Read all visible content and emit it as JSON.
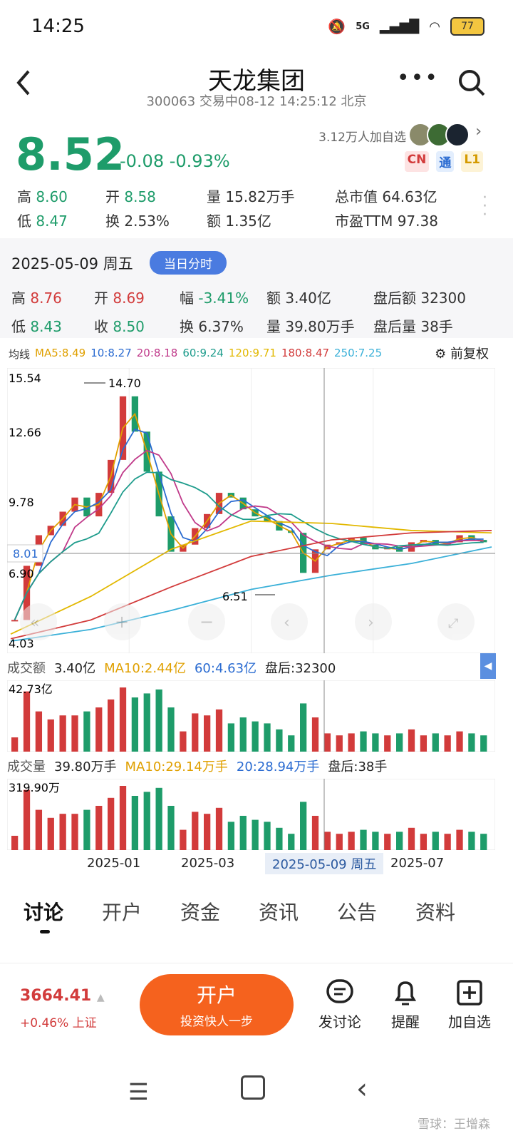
{
  "status_bar": {
    "time": "14:25",
    "network": "5G",
    "battery": "77"
  },
  "header": {
    "title": "天龙集团",
    "subtitle": "300063 交易中08-12 14:25:12 北京"
  },
  "quote": {
    "price": "8.52",
    "change": "-0.08",
    "change_pct": "-0.93%",
    "followers": "3.12万人加自选",
    "badges": [
      "CN",
      "通",
      "L1"
    ],
    "high_label": "高",
    "high": "8.60",
    "open_label": "开",
    "open": "8.58",
    "volume_label": "量",
    "volume": "15.82万手",
    "mktcap_label": "总市值",
    "mktcap": "64.63亿",
    "low_label": "低",
    "low": "8.47",
    "turnover_label": "换",
    "turnover": "2.53%",
    "amount_label": "额",
    "amount": "1.35亿",
    "pe_label": "市盈TTM",
    "pe": "97.38"
  },
  "day_panel": {
    "date": "2025-05-09 周五",
    "intraday_btn": "当日分时",
    "high_label": "高",
    "high": "8.76",
    "open_label": "开",
    "open": "8.69",
    "amp_label": "幅",
    "amp": "-3.41%",
    "amt_label": "额",
    "amt": "3.40亿",
    "after_amt_label": "盘后额",
    "after_amt": "32300",
    "low_label": "低",
    "low": "8.43",
    "close_label": "收",
    "close": "8.50",
    "turn_label": "换",
    "turn": "6.37%",
    "vol_label": "量",
    "vol": "39.80万手",
    "after_vol_label": "盘后量",
    "after_vol": "38手"
  },
  "ma_legend": {
    "label": "均线",
    "items": [
      {
        "text": "MA5:8.49",
        "color": "#e0a000"
      },
      {
        "text": "10:8.27",
        "color": "#2a6bd1"
      },
      {
        "text": "20:8.18",
        "color": "#c03a8a"
      },
      {
        "text": "60:9.24",
        "color": "#1e9c8c"
      },
      {
        "text": "120:9.71",
        "color": "#e2b800"
      },
      {
        "text": "180:8.47",
        "color": "#d23b3b"
      },
      {
        "text": "250:7.25",
        "color": "#3ab0d8"
      }
    ],
    "adjust": "前复权"
  },
  "chart_data": {
    "type": "candlestick",
    "y_ticks": [
      "15.54",
      "12.66",
      "9.78",
      "6.90",
      "4.03"
    ],
    "current_price_marker": "8.01",
    "annotations": [
      {
        "text": "14.70",
        "kind": "high"
      },
      {
        "text": "6.51",
        "kind": "low"
      }
    ],
    "x_labels": [
      "2025-01",
      "2025-03",
      "2025-05-09 周五",
      "2025-07"
    ],
    "close_series": [
      5.2,
      7.5,
      8.8,
      9.2,
      9.8,
      10.4,
      9.6,
      10.6,
      12.0,
      14.7,
      13.2,
      11.5,
      9.6,
      8.1,
      8.4,
      9.1,
      9.7,
      10.6,
      10.4,
      9.9,
      9.6,
      9.4,
      9.0,
      8.9,
      7.2,
      8.2,
      8.4,
      8.5,
      8.7,
      8.4,
      8.2,
      8.3,
      8.1,
      8.5,
      8.6,
      8.4,
      8.5,
      8.8,
      8.6,
      8.5
    ]
  },
  "amount_bar": {
    "label": "成交额",
    "value": "3.40亿",
    "ma10": "MA10:2.44亿",
    "ma60": "60:4.63亿",
    "after": "盘后:32300",
    "top": "42.73亿"
  },
  "volume_bar": {
    "label": "成交量",
    "value": "39.80万手",
    "ma10": "MA10:29.14万手",
    "ma20": "20:28.94万手",
    "after": "盘后:38手",
    "top": "319.90万"
  },
  "tabs": [
    "讨论",
    "开户",
    "资金",
    "资讯",
    "公告",
    "资料"
  ],
  "bottom": {
    "index_value": "3664.41",
    "index_change": "+0.46% 上证",
    "open_btn": "开户",
    "open_sub": "投资快人一步",
    "actions": [
      "发讨论",
      "提醒",
      "加自选"
    ]
  },
  "watermark": "雪球：王增森"
}
